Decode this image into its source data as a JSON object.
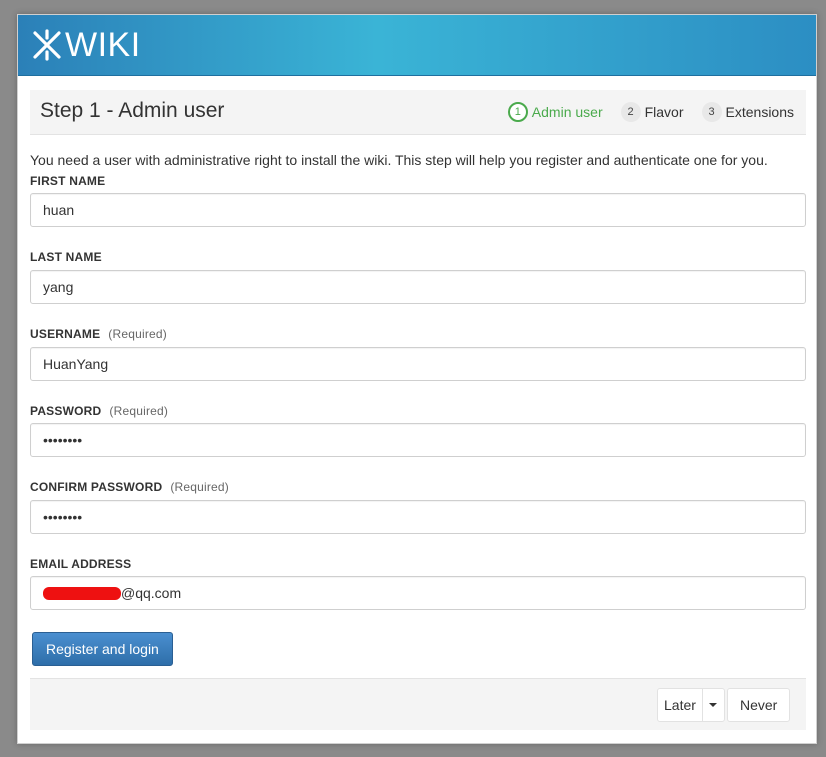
{
  "app": {
    "logo_text": "WIKI"
  },
  "step": {
    "title": "Step 1 - Admin user",
    "items": [
      {
        "number": "1",
        "label": "Admin user",
        "active": true
      },
      {
        "number": "2",
        "label": "Flavor",
        "active": false
      },
      {
        "number": "3",
        "label": "Extensions",
        "active": false
      }
    ]
  },
  "intro": "You need a user with administrative right to install the wiki. This step will help you register and authenticate one for you.",
  "form": {
    "first_name": {
      "label": "FIRST NAME",
      "value": "huan"
    },
    "last_name": {
      "label": "LAST NAME",
      "value": "yang"
    },
    "username": {
      "label": "USERNAME",
      "required": "(Required)",
      "value": "HuanYang"
    },
    "password": {
      "label": "PASSWORD",
      "required": "(Required)",
      "value": "••••••••"
    },
    "confirm_password": {
      "label": "CONFIRM PASSWORD",
      "required": "(Required)",
      "value": "••••••••"
    },
    "email": {
      "label": "EMAIL ADDRESS",
      "value_suffix": "@qq.com"
    }
  },
  "buttons": {
    "register": "Register and login",
    "later": "Later",
    "never": "Never"
  },
  "colors": {
    "header_blue": "#2b80b8",
    "active_step": "#4aaa4c",
    "register_button": "#2e6ea9",
    "redaction": "#ee1111"
  }
}
